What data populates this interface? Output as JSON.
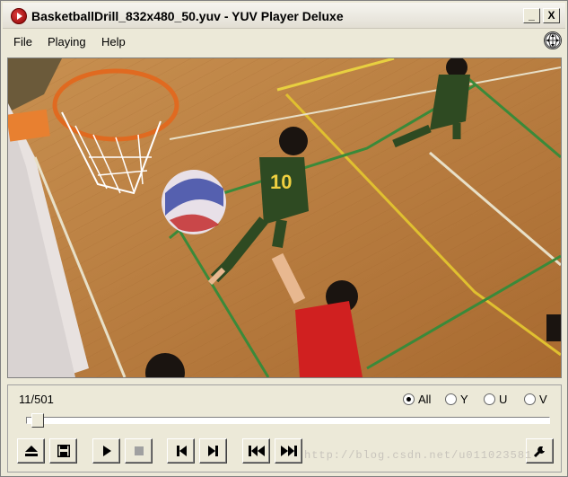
{
  "window": {
    "title": "BasketballDrill_832x480_50.yuv - YUV Player Deluxe",
    "minimize_label": "_",
    "close_label": "X"
  },
  "menu": {
    "items": [
      {
        "label": "File"
      },
      {
        "label": "Playing"
      },
      {
        "label": "Help"
      }
    ]
  },
  "video": {
    "content": "basketball drill frame",
    "players": {
      "jersey_number": "10"
    }
  },
  "controls": {
    "frame_counter": "11/501",
    "channel_options": [
      {
        "label": "All",
        "selected": true
      },
      {
        "label": "Y",
        "selected": false
      },
      {
        "label": "U",
        "selected": false
      },
      {
        "label": "V",
        "selected": false
      }
    ],
    "position_fraction": 0.022,
    "buttons": [
      {
        "name": "eject-icon"
      },
      {
        "name": "save-icon"
      },
      {
        "name": "play-icon"
      },
      {
        "name": "stop-icon"
      },
      {
        "name": "prev-frame-icon"
      },
      {
        "name": "next-frame-icon"
      },
      {
        "name": "rewind-icon"
      },
      {
        "name": "fast-forward-icon"
      },
      {
        "name": "wrench-icon"
      }
    ]
  },
  "watermark": "http://blog.csdn.net/u011023581"
}
